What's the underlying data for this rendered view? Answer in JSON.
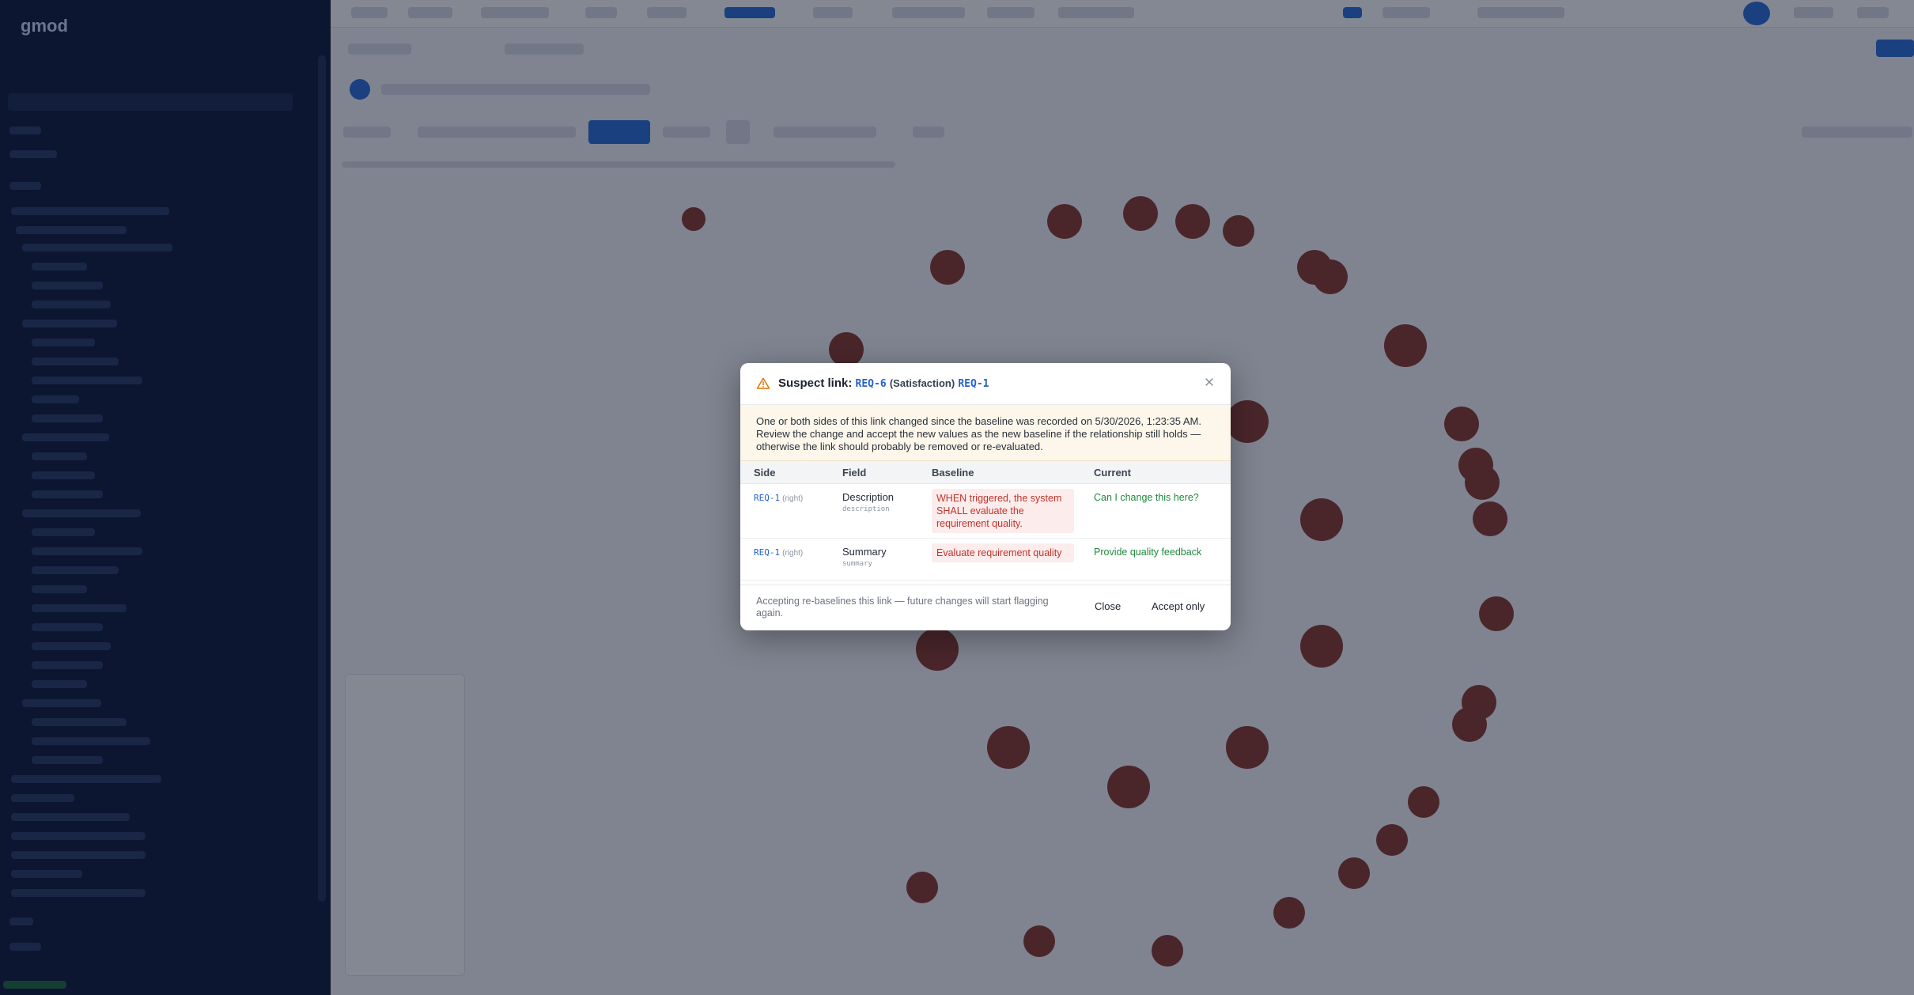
{
  "app": {
    "brand": "gmod"
  },
  "modal": {
    "title_label": "Suspect link:",
    "source_req": "REQ-6",
    "relation": "(Satisfaction)",
    "target_req": "REQ-1",
    "close_icon": "close-icon",
    "warning_icon": "warning-triangle-icon",
    "notice_before": "One or both sides of this link changed since the baseline was recorded on ",
    "notice_timestamp": "5/30/2026, 1:23:35 AM",
    "notice_after": ". Review the change and accept the new values as the new baseline if the relationship still holds — otherwise the link should probably be removed or re-evaluated.",
    "columns": [
      "Side",
      "Field",
      "Baseline",
      "Current"
    ],
    "rows": [
      {
        "req": "REQ-1",
        "side": "(right)",
        "field": "Description",
        "field_key": "description",
        "baseline": "WHEN triggered, the system SHALL evaluate the requirement quality.",
        "current": "Can I change this here?"
      },
      {
        "req": "REQ-1",
        "side": "(right)",
        "field": "Summary",
        "field_key": "summary",
        "baseline": "Evaluate requirement quality",
        "current": "Provide quality feedback"
      }
    ],
    "footer_note": "Accepting re-baselines this link — future changes will start flagging again.",
    "close_label": "Close",
    "accept_label": "Accept only"
  },
  "colors": {
    "accent": "#2563c9",
    "warning": "#d97706",
    "baseline_text": "#c0342b",
    "current_text": "#1f8a3f"
  }
}
